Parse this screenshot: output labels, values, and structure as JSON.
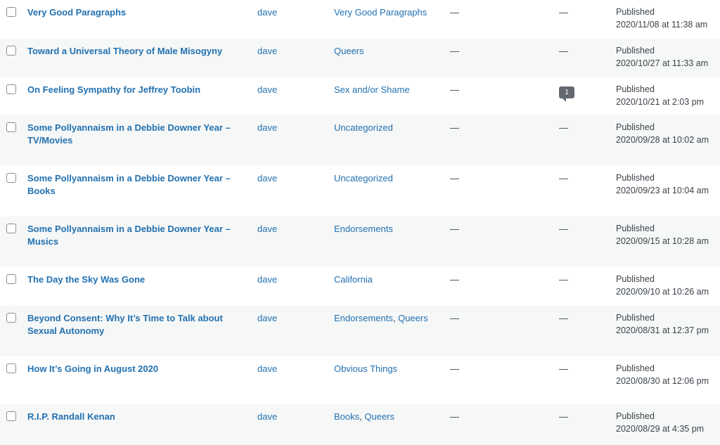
{
  "posts": [
    {
      "title": "Very Good Paragraphs",
      "author": "dave",
      "categories": [
        "Very Good Paragraphs"
      ],
      "tags": "—",
      "comments": "—",
      "status": "Published",
      "date": "2020/11/08 at 11:38 am"
    },
    {
      "title": "Toward a Universal Theory of Male Misogyny",
      "author": "dave",
      "categories": [
        "Queers"
      ],
      "tags": "—",
      "comments": "—",
      "status": "Published",
      "date": "2020/10/27 at 11:33 am"
    },
    {
      "title": "On Feeling Sympathy for Jeffrey Toobin",
      "author": "dave",
      "categories": [
        "Sex and/or Shame"
      ],
      "tags": "—",
      "comments": "1",
      "status": "Published",
      "date": "2020/10/21 at 2:03 pm"
    },
    {
      "title": "Some Pollyannaism in a Debbie Downer Year – TV/Movies",
      "author": "dave",
      "categories": [
        "Uncategorized"
      ],
      "tags": "—",
      "comments": "—",
      "status": "Published",
      "date": "2020/09/28 at 10:02 am"
    },
    {
      "title": "Some Pollyannaism in a Debbie Downer Year – Books",
      "author": "dave",
      "categories": [
        "Uncategorized"
      ],
      "tags": "—",
      "comments": "—",
      "status": "Published",
      "date": "2020/09/23 at 10:04 am"
    },
    {
      "title": "Some Pollyannaism in a Debbie Downer Year – Musics",
      "author": "dave",
      "categories": [
        "Endorsements"
      ],
      "tags": "—",
      "comments": "—",
      "status": "Published",
      "date": "2020/09/15 at 10:28 am"
    },
    {
      "title": "The Day the Sky Was Gone",
      "author": "dave",
      "categories": [
        "California"
      ],
      "tags": "—",
      "comments": "—",
      "status": "Published",
      "date": "2020/09/10 at 10:26 am"
    },
    {
      "title": "Beyond Consent: Why It’s Time to Talk about Sexual Autonomy",
      "author": "dave",
      "categories": [
        "Endorsements",
        "Queers"
      ],
      "tags": "—",
      "comments": "—",
      "status": "Published",
      "date": "2020/08/31 at 12:37 pm"
    },
    {
      "title": "How It’s Going in August 2020",
      "author": "dave",
      "categories": [
        "Obvious Things"
      ],
      "tags": "—",
      "comments": "—",
      "status": "Published",
      "date": "2020/08/30 at 12:06 pm"
    },
    {
      "title": "R.I.P. Randall Kenan",
      "author": "dave",
      "categories": [
        "Books",
        "Queers"
      ],
      "tags": "—",
      "comments": "—",
      "status": "Published",
      "date": "2020/08/29 at 4:35 pm"
    }
  ],
  "colors": {
    "link": "#2271b1",
    "text": "#3c434a",
    "alt_row": "#f6f7f7",
    "bubble": "#646970"
  }
}
